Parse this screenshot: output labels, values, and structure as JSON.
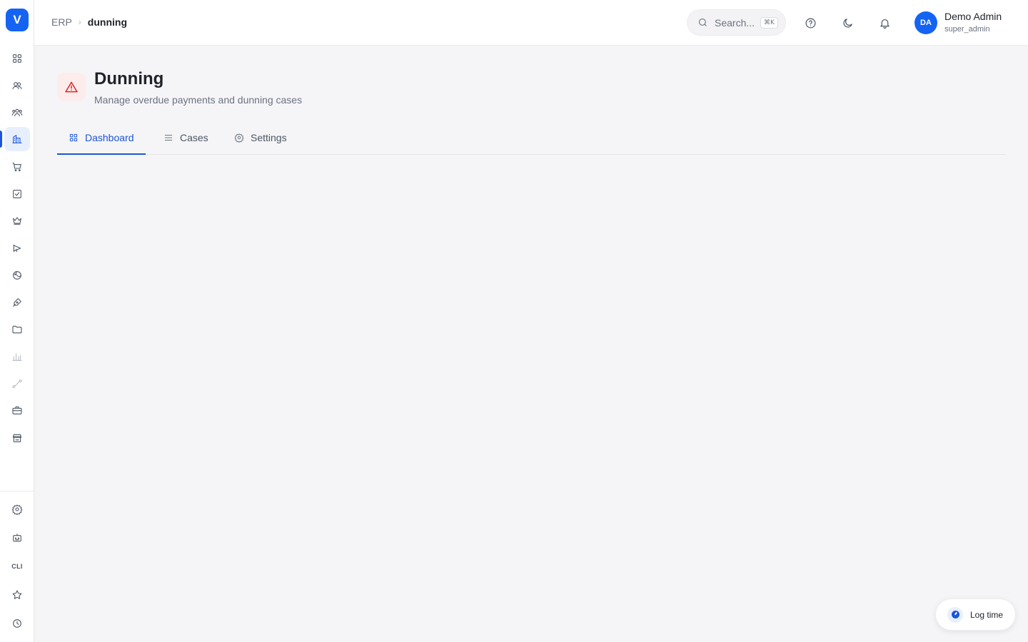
{
  "app": {
    "logo_letter": "V"
  },
  "sidebar": {
    "items": [
      {
        "icon": "grid-icon"
      },
      {
        "icon": "users-icon"
      },
      {
        "icon": "team-icon"
      },
      {
        "icon": "building-icon",
        "active": true
      },
      {
        "icon": "cart-icon"
      },
      {
        "icon": "checkbox-icon"
      },
      {
        "icon": "crown-icon"
      },
      {
        "icon": "megaphone-icon"
      },
      {
        "icon": "globe-icon"
      },
      {
        "icon": "pen-icon"
      },
      {
        "icon": "folder-icon"
      },
      {
        "icon": "bar-chart-icon"
      },
      {
        "icon": "route-icon"
      },
      {
        "icon": "briefcase-icon"
      },
      {
        "icon": "store-icon"
      }
    ],
    "bottom": [
      {
        "icon": "gear-icon"
      },
      {
        "icon": "bot-icon"
      },
      {
        "label": "CLI"
      },
      {
        "icon": "star-icon"
      },
      {
        "icon": "clock-icon"
      }
    ]
  },
  "header": {
    "breadcrumb": {
      "root": "ERP",
      "separator": "›",
      "current": "dunning"
    },
    "search": {
      "placeholder": "Search...",
      "shortcut": "⌘K"
    },
    "user": {
      "initials": "DA",
      "name": "Demo Admin",
      "role": "super_admin"
    }
  },
  "page": {
    "title": "Dunning",
    "subtitle": "Manage overdue payments and dunning cases",
    "icon": "alert-triangle-icon",
    "tabs": [
      {
        "label": "Dashboard",
        "icon": "grid-icon",
        "active": true
      },
      {
        "label": "Cases",
        "icon": "list-icon"
      },
      {
        "label": "Settings",
        "icon": "gear-icon"
      }
    ]
  },
  "log_time": {
    "label": "Log time"
  },
  "colors": {
    "accent": "#1b55d9",
    "brand": "#1463f3",
    "danger": "#dc2626"
  }
}
